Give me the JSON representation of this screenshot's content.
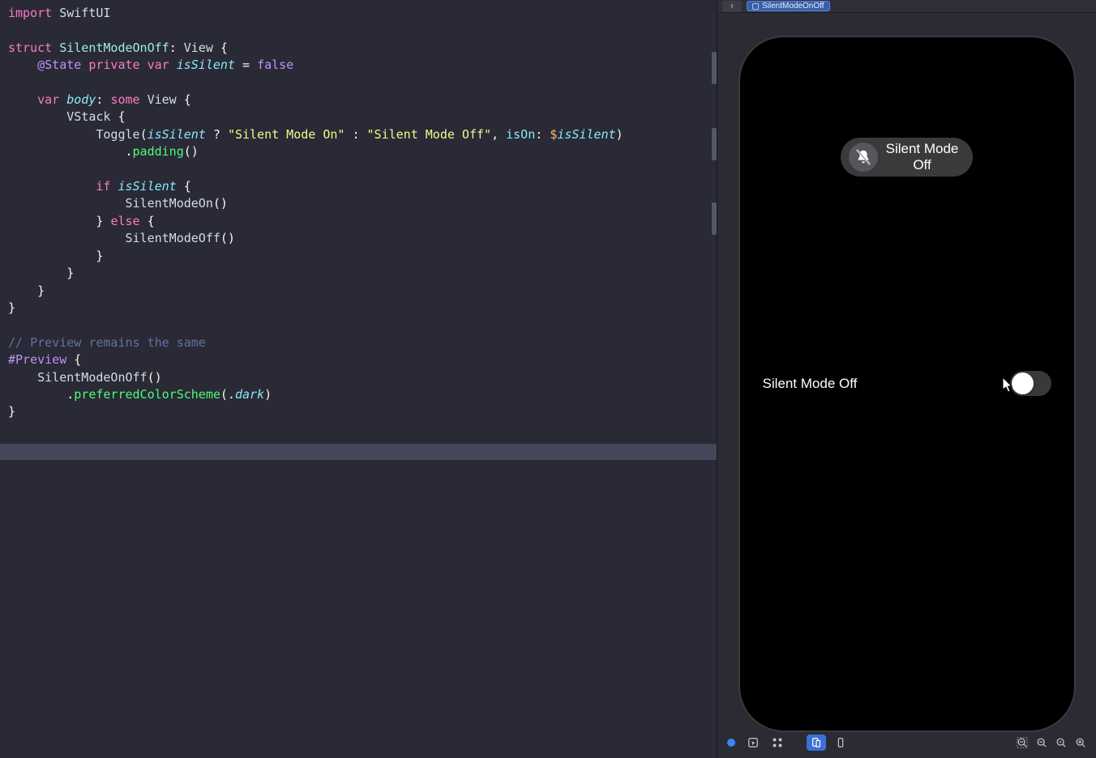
{
  "preview_header": {
    "file_name": "SilentModeOnOff"
  },
  "code": {
    "lines": [
      [
        {
          "c": "tok-key-pink",
          "t": "import"
        },
        {
          "c": "tok-plain",
          "t": " "
        },
        {
          "c": "tok-type",
          "t": "SwiftUI"
        }
      ],
      [],
      [
        {
          "c": "tok-key-pink",
          "t": "struct"
        },
        {
          "c": "tok-plain",
          "t": " "
        },
        {
          "c": "tok-name",
          "t": "SilentModeOnOff"
        },
        {
          "c": "tok-plain",
          "t": ": "
        },
        {
          "c": "tok-type",
          "t": "View"
        },
        {
          "c": "tok-plain",
          "t": " {"
        }
      ],
      [
        {
          "c": "tok-plain",
          "t": "    "
        },
        {
          "c": "tok-attr",
          "t": "@State"
        },
        {
          "c": "tok-plain",
          "t": " "
        },
        {
          "c": "tok-key-pink",
          "t": "private"
        },
        {
          "c": "tok-plain",
          "t": " "
        },
        {
          "c": "tok-key-pink",
          "t": "var"
        },
        {
          "c": "tok-plain",
          "t": " "
        },
        {
          "c": "tok-var",
          "t": "isSilent"
        },
        {
          "c": "tok-plain",
          "t": " = "
        },
        {
          "c": "tok-bool",
          "t": "false"
        }
      ],
      [],
      [
        {
          "c": "tok-plain",
          "t": "    "
        },
        {
          "c": "tok-key-pink",
          "t": "var"
        },
        {
          "c": "tok-plain",
          "t": " "
        },
        {
          "c": "tok-var",
          "t": "body"
        },
        {
          "c": "tok-plain",
          "t": ": "
        },
        {
          "c": "tok-key-pink",
          "t": "some"
        },
        {
          "c": "tok-plain",
          "t": " "
        },
        {
          "c": "tok-type",
          "t": "View"
        },
        {
          "c": "tok-plain",
          "t": " {"
        }
      ],
      [
        {
          "c": "tok-plain",
          "t": "        "
        },
        {
          "c": "tok-type",
          "t": "VStack"
        },
        {
          "c": "tok-plain",
          "t": " {"
        }
      ],
      [
        {
          "c": "tok-plain",
          "t": "            "
        },
        {
          "c": "tok-type",
          "t": "Toggle"
        },
        {
          "c": "tok-plain",
          "t": "("
        },
        {
          "c": "tok-var",
          "t": "isSilent"
        },
        {
          "c": "tok-plain",
          "t": " ? "
        },
        {
          "c": "tok-str",
          "t": "\"Silent Mode On\""
        },
        {
          "c": "tok-plain",
          "t": " : "
        },
        {
          "c": "tok-str",
          "t": "\"Silent Mode Off\""
        },
        {
          "c": "tok-plain",
          "t": ", "
        },
        {
          "c": "tok-label",
          "t": "isOn"
        },
        {
          "c": "tok-plain",
          "t": ": "
        },
        {
          "c": "tok-modifier",
          "t": "$"
        },
        {
          "c": "tok-var",
          "t": "isSilent"
        },
        {
          "c": "tok-plain",
          "t": ")"
        }
      ],
      [
        {
          "c": "tok-plain",
          "t": "                ."
        },
        {
          "c": "tok-func",
          "t": "padding"
        },
        {
          "c": "tok-plain",
          "t": "()"
        }
      ],
      [],
      [
        {
          "c": "tok-plain",
          "t": "            "
        },
        {
          "c": "tok-key-pink",
          "t": "if"
        },
        {
          "c": "tok-plain",
          "t": " "
        },
        {
          "c": "tok-var",
          "t": "isSilent"
        },
        {
          "c": "tok-plain",
          "t": " {"
        }
      ],
      [
        {
          "c": "tok-plain",
          "t": "                "
        },
        {
          "c": "tok-type",
          "t": "SilentModeOn"
        },
        {
          "c": "tok-plain",
          "t": "()"
        }
      ],
      [
        {
          "c": "tok-plain",
          "t": "            } "
        },
        {
          "c": "tok-key-pink",
          "t": "else"
        },
        {
          "c": "tok-plain",
          "t": " {"
        }
      ],
      [
        {
          "c": "tok-plain",
          "t": "                "
        },
        {
          "c": "tok-type",
          "t": "SilentModeOff"
        },
        {
          "c": "tok-plain",
          "t": "()"
        }
      ],
      [
        {
          "c": "tok-plain",
          "t": "            }"
        }
      ],
      [
        {
          "c": "tok-plain",
          "t": "        }"
        }
      ],
      [
        {
          "c": "tok-plain",
          "t": "    }"
        }
      ],
      [
        {
          "c": "tok-plain",
          "t": "}"
        }
      ],
      [],
      [
        {
          "c": "tok-comment",
          "t": "// Preview remains the same"
        }
      ],
      [
        {
          "c": "tok-attr",
          "t": "#Preview"
        },
        {
          "c": "tok-plain",
          "t": " {"
        }
      ],
      [
        {
          "c": "tok-plain",
          "t": "    "
        },
        {
          "c": "tok-type",
          "t": "SilentModeOnOff"
        },
        {
          "c": "tok-plain",
          "t": "()"
        }
      ],
      [
        {
          "c": "tok-plain",
          "t": "        ."
        },
        {
          "c": "tok-func",
          "t": "preferredColorScheme"
        },
        {
          "c": "tok-plain",
          "t": "(."
        },
        {
          "c": "tok-var",
          "t": "dark"
        },
        {
          "c": "tok-plain",
          "t": ")"
        }
      ],
      [
        {
          "c": "tok-plain",
          "t": "}"
        }
      ]
    ]
  },
  "preview": {
    "banner_line1": "Silent Mode",
    "banner_line2": "Off",
    "toggle_label": "Silent Mode Off",
    "toggle_on": false
  },
  "icons": {
    "pin": "⇪",
    "zoom_out_full": "zoom-out-full",
    "zoom_out": "zoom-out",
    "zoom_in": "zoom-in",
    "zoom_in_full": "zoom-in-full"
  }
}
